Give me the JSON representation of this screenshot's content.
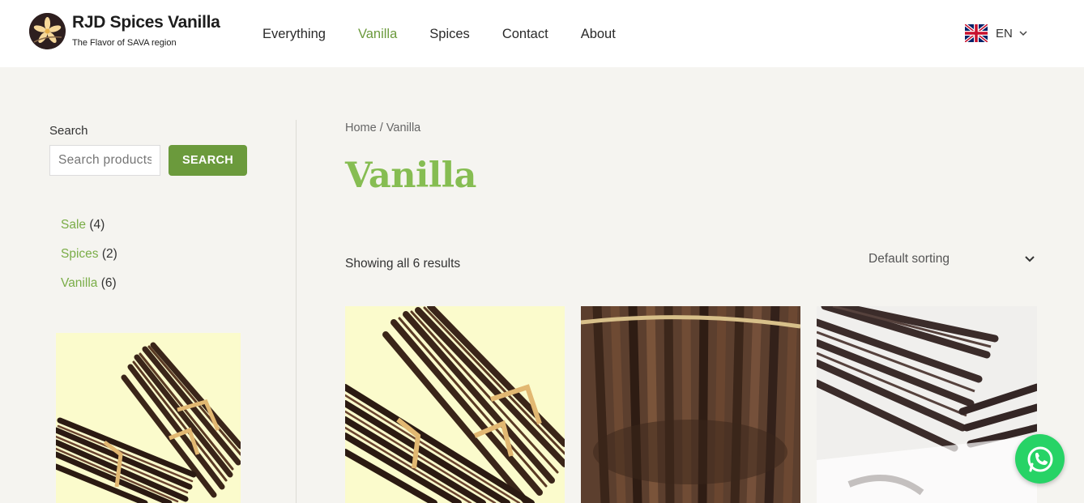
{
  "brand": {
    "name": "RJD Spices Vanilla",
    "tagline": "The Flavor of SAVA region"
  },
  "nav": {
    "items": [
      {
        "label": "Everything",
        "active": false
      },
      {
        "label": "Vanilla",
        "active": true
      },
      {
        "label": "Spices",
        "active": false
      },
      {
        "label": "Contact",
        "active": false
      },
      {
        "label": "About",
        "active": false
      }
    ]
  },
  "language": {
    "code": "EN",
    "flag_icon": "uk-flag-icon"
  },
  "sidebar": {
    "search_label": "Search",
    "search_placeholder": "Search products…",
    "search_button": "SEARCH",
    "categories": [
      {
        "name": "Sale",
        "count": "(4)"
      },
      {
        "name": "Spices",
        "count": "(2)"
      },
      {
        "name": "Vanilla",
        "count": "(6)"
      }
    ]
  },
  "breadcrumb": {
    "home": "Home",
    "separator": "/",
    "current": "Vanilla"
  },
  "main": {
    "title": "Vanilla",
    "result_count": "Showing all 6 results",
    "sort_selected": "Default sorting"
  },
  "colors": {
    "accent_green": "#6b9a3c",
    "title_green": "#86bd52",
    "link_green": "#7aad47",
    "whatsapp_green": "#27d366"
  },
  "icons": {
    "whatsapp": "whatsapp-icon",
    "sort_chevron": "chevron-down-icon"
  }
}
